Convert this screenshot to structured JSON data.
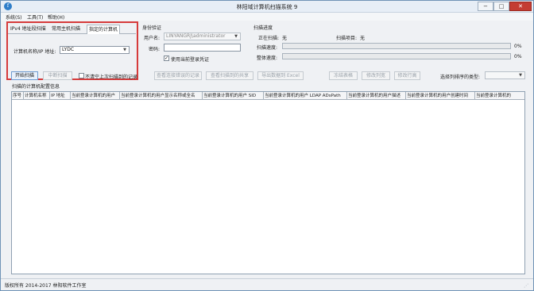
{
  "window": {
    "title": "林阳域计算机扫描系统 9",
    "app_icon_glyph": "f",
    "minimize": "−",
    "maximize": "□",
    "close": "✕"
  },
  "menu": {
    "items": [
      "系统(S)",
      "工具(T)",
      "帮助(H)"
    ]
  },
  "scan_target": {
    "tabs": [
      "IPv4 地址段扫描",
      "常用主机扫描",
      "指定的计算机"
    ],
    "active_tab_index": 2,
    "computer_label": "计算机名称/IP 地址:",
    "computer_value": "LYDC"
  },
  "auth": {
    "section_title": "身份验证",
    "user_label": "用户名:",
    "user_value": "LINYANGRJ\\administrator",
    "password_label": "密码:",
    "password_value": "",
    "use_current_label": "使用当前登录凭证",
    "use_current_checked": true
  },
  "progress": {
    "section_title": "扫描进度",
    "scanning_label": "正在扫描:",
    "scanning_value": "无",
    "item_label": "扫描项目:",
    "item_value": "无",
    "scan_speed_label": "扫描速度:",
    "scan_speed_percent": 0,
    "scan_speed_text": "0%",
    "parse_speed_label": "整体速度:",
    "parse_speed_percent": 0,
    "parse_speed_text": "0%"
  },
  "actions": {
    "start_scan": "开始扫描",
    "stop_scan": "中断扫描",
    "no_clear_label": "不清空上次扫描到的记录",
    "no_clear_checked": false,
    "view_errors": "查看连接错误的记录",
    "view_shares": "查看扫描到的共享",
    "export_excel": "导出数据到 Excel",
    "freeze": "冻结表格",
    "modify_columns": "修改列宽",
    "sort_rows": "修改行高",
    "sort_type_label": "选择列排序的类型:",
    "sort_type_value": ""
  },
  "results": {
    "section_title": "扫描的计算机配置信息",
    "columns": [
      "序号",
      "计算机名称",
      "IP 地址",
      "当前登录计算机的用户",
      "当前登录计算机的用户显示名称或全名",
      "当前登录计算机的用户 SID",
      "当前登录计算机的用户 LDAP ADsPath",
      "当前登录计算机的用户描述",
      "当前登录计算机的用户创建时间",
      "当前登录计算机的"
    ]
  },
  "statusbar": {
    "text": "版权所有 2014-2017 林阳软件工作室"
  }
}
